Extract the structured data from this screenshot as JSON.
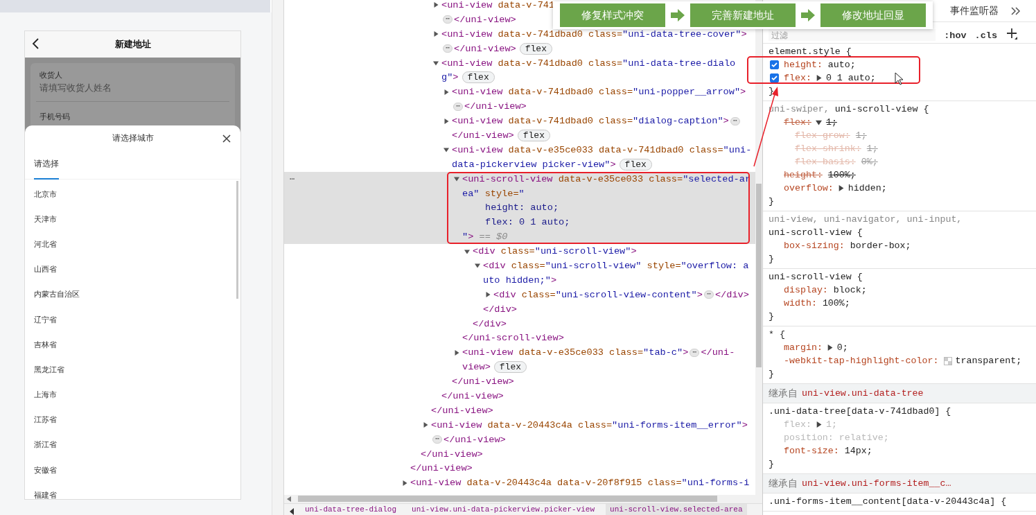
{
  "left_pane": {
    "page_title": "新建地址",
    "form": [
      {
        "label": "收货人",
        "placeholder": "请填写收货人姓名"
      },
      {
        "label": "手机号码"
      }
    ],
    "picker": {
      "title": "请选择城市",
      "tabs": [
        {
          "label": "请选择",
          "selected": true
        }
      ],
      "items": [
        "北京市",
        "天津市",
        "河北省",
        "山西省",
        "内蒙古自治区",
        "辽宁省",
        "吉林省",
        "黑龙江省",
        "上海市",
        "江苏省",
        "浙江省",
        "安徽省",
        "福建省"
      ]
    }
  },
  "overlay_steps": [
    "修复样式冲突",
    "完善新建地址",
    "修改地址回显"
  ],
  "elements": {
    "tree": [
      {
        "close": [
          {
            "kind": "tag",
            "text": "</uni-view>"
          }
        ],
        "children": [
          {
            "close": [
              {
                "kind": "tag",
                "text": "</uni-view>"
              }
            ],
            "children": [
              {
                "close": [
                  {
                    "kind": "tag",
                    "text": "</uni-view>"
                  }
                ],
                "children": [
                  {
                    "lines": [
                      [
                        {
                          "kind": "tag",
                          "text": "<uni-view"
                        },
                        {
                          "kind": "attr",
                          "text": " data-v-741"
                        }
                      ],
                      [
                        {
                          "kind": "more",
                          "text": "⋯"
                        },
                        {
                          "kind": "tag",
                          "text": "</uni-view>"
                        }
                      ]
                    ],
                    "expanded": false,
                    "selected": false
                  },
                  {
                    "lines": [
                      [
                        {
                          "kind": "tag",
                          "text": "<uni-view"
                        },
                        {
                          "kind": "attr",
                          "text": " data-v-741dbad0"
                        },
                        {
                          "kind": "attr",
                          "text": " class="
                        },
                        {
                          "kind": "value",
                          "text": "\"uni-data-tree-cover\""
                        },
                        {
                          "kind": "tag",
                          "text": ">"
                        }
                      ],
                      [
                        {
                          "kind": "more",
                          "text": "⋯"
                        },
                        {
                          "kind": "tag",
                          "text": "</uni-view>"
                        }
                      ]
                    ],
                    "badge": "flex",
                    "expanded": false,
                    "selected": false
                  },
                  {
                    "lines": [
                      [
                        {
                          "kind": "tag",
                          "text": "<uni-view"
                        },
                        {
                          "kind": "attr",
                          "text": " data-v-741dbad0"
                        },
                        {
                          "kind": "attr",
                          "text": " class="
                        },
                        {
                          "kind": "value",
                          "text": "\"uni-data-tree-dialo"
                        }
                      ],
                      [
                        {
                          "kind": "value",
                          "text": "g\""
                        },
                        {
                          "kind": "tag",
                          "text": ">"
                        }
                      ]
                    ],
                    "badge": "flex",
                    "expanded": true,
                    "selected": false,
                    "close": [
                      {
                        "kind": "tag",
                        "text": "</uni-view>"
                      }
                    ],
                    "children": [
                      {
                        "lines": [
                          [
                            {
                              "kind": "tag",
                              "text": "<uni-view"
                            },
                            {
                              "kind": "attr",
                              "text": " data-v-741dbad0"
                            },
                            {
                              "kind": "attr",
                              "text": " class="
                            },
                            {
                              "kind": "value",
                              "text": "\"uni-popper__arrow\""
                            },
                            {
                              "kind": "tag",
                              "text": ">"
                            }
                          ],
                          [
                            {
                              "kind": "more",
                              "text": "⋯"
                            },
                            {
                              "kind": "tag",
                              "text": "</uni-view>"
                            }
                          ]
                        ],
                        "expanded": false,
                        "selected": false
                      },
                      {
                        "lines": [
                          [
                            {
                              "kind": "tag",
                              "text": "<uni-view"
                            },
                            {
                              "kind": "attr",
                              "text": " data-v-741dbad0"
                            },
                            {
                              "kind": "attr",
                              "text": " class="
                            },
                            {
                              "kind": "value",
                              "text": "\"dialog-caption\""
                            },
                            {
                              "kind": "tag",
                              "text": ">"
                            },
                            {
                              "kind": "more",
                              "text": "⋯"
                            }
                          ],
                          [
                            {
                              "kind": "tag",
                              "text": "</uni-view>"
                            }
                          ]
                        ],
                        "badge": "flex",
                        "expanded": false,
                        "selected": false
                      },
                      {
                        "lines": [
                          [
                            {
                              "kind": "tag",
                              "text": "<uni-view"
                            },
                            {
                              "kind": "attr",
                              "text": " data-v-e35ce033"
                            },
                            {
                              "kind": "attr",
                              "text": " data-v-741dbad0"
                            },
                            {
                              "kind": "attr",
                              "text": " class="
                            },
                            {
                              "kind": "value",
                              "text": "\"uni-"
                            }
                          ],
                          [
                            {
                              "kind": "value",
                              "text": "data-pickerview picker-view\""
                            },
                            {
                              "kind": "tag",
                              "text": ">"
                            }
                          ]
                        ],
                        "badge": "flex",
                        "expanded": true,
                        "selected": false,
                        "close": [
                          {
                            "kind": "tag",
                            "text": "</uni-view>"
                          }
                        ],
                        "children": [
                          {
                            "lines": [
                              [
                                {
                                  "kind": "tag",
                                  "text": "<uni-scroll-view"
                                },
                                {
                                  "kind": "attr",
                                  "text": " data-v-e35ce033"
                                },
                                {
                                  "kind": "attr",
                                  "text": " class="
                                },
                                {
                                  "kind": "value",
                                  "text": "\"selected-ar"
                                }
                              ],
                              [
                                {
                                  "kind": "value",
                                  "text": "ea\""
                                },
                                {
                                  "kind": "attr",
                                  "text": " style="
                                },
                                {
                                  "kind": "value",
                                  "text": "\""
                                }
                              ],
                              [
                                {
                                  "kind": "css",
                                  "text": "height: auto;"
                                }
                              ],
                              [
                                {
                                  "kind": "css",
                                  "text": "flex: 0 1 auto;"
                                }
                              ],
                              [
                                {
                                  "kind": "value",
                                  "text": "\""
                                },
                                {
                                  "kind": "tag",
                                  "text": ">"
                                },
                                {
                                  "kind": "ref",
                                  "text": " == $0"
                                }
                              ]
                            ],
                            "gutter": "⋯",
                            "expanded": true,
                            "selected": true,
                            "highlighted": true,
                            "close": [
                              {
                                "kind": "tag",
                                "text": "</uni-scroll-view>"
                              }
                            ],
                            "children": [
                              {
                                "lines": [
                                  [
                                    {
                                      "kind": "tag",
                                      "text": "<div"
                                    },
                                    {
                                      "kind": "attr",
                                      "text": " class="
                                    },
                                    {
                                      "kind": "value",
                                      "text": "\"uni-scroll-view\""
                                    },
                                    {
                                      "kind": "tag",
                                      "text": ">"
                                    }
                                  ]
                                ],
                                "expanded": true,
                                "selected": false,
                                "close": [
                                  {
                                    "kind": "tag",
                                    "text": "</div>"
                                  }
                                ],
                                "children": [
                                  {
                                    "lines": [
                                      [
                                        {
                                          "kind": "tag",
                                          "text": "<div"
                                        },
                                        {
                                          "kind": "attr",
                                          "text": " class="
                                        },
                                        {
                                          "kind": "value",
                                          "text": "\"uni-scroll-view\""
                                        },
                                        {
                                          "kind": "attr",
                                          "text": " style="
                                        },
                                        {
                                          "kind": "value",
                                          "text": "\"overflow: a"
                                        }
                                      ],
                                      [
                                        {
                                          "kind": "value",
                                          "text": "uto hidden;\""
                                        },
                                        {
                                          "kind": "tag",
                                          "text": ">"
                                        }
                                      ]
                                    ],
                                    "expanded": true,
                                    "selected": false,
                                    "close": [
                                      {
                                        "kind": "tag",
                                        "text": "</div>"
                                      }
                                    ],
                                    "children": [
                                      {
                                        "lines": [
                                          [
                                            {
                                              "kind": "tag",
                                              "text": "<div"
                                            },
                                            {
                                              "kind": "attr",
                                              "text": " class="
                                            },
                                            {
                                              "kind": "value",
                                              "text": "\"uni-scroll-view-content\""
                                            },
                                            {
                                              "kind": "tag",
                                              "text": ">"
                                            },
                                            {
                                              "kind": "more",
                                              "text": "⋯"
                                            },
                                            {
                                              "kind": "tag",
                                              "text": "</div>"
                                            }
                                          ]
                                        ],
                                        "expanded": false,
                                        "selected": false
                                      }
                                    ]
                                  }
                                ]
                              }
                            ]
                          },
                          {
                            "lines": [
                              [
                                {
                                  "kind": "tag",
                                  "text": "<uni-view"
                                },
                                {
                                  "kind": "attr",
                                  "text": " data-v-e35ce033"
                                },
                                {
                                  "kind": "attr",
                                  "text": " class="
                                },
                                {
                                  "kind": "value",
                                  "text": "\"tab-c\""
                                },
                                {
                                  "kind": "tag",
                                  "text": ">"
                                },
                                {
                                  "kind": "more",
                                  "text": "⋯"
                                },
                                {
                                  "kind": "tag",
                                  "text": "</uni-"
                                }
                              ],
                              [
                                {
                                  "kind": "tag",
                                  "text": "view>"
                                }
                              ]
                            ],
                            "badge": "flex",
                            "expanded": false,
                            "selected": false
                          }
                        ]
                      }
                    ]
                  }
                ]
              },
              {
                "lines": [
                  [
                    {
                      "kind": "tag",
                      "text": "<uni-view"
                    },
                    {
                      "kind": "attr",
                      "text": " data-v-20443c4a"
                    },
                    {
                      "kind": "attr",
                      "text": " class="
                    },
                    {
                      "kind": "value",
                      "text": "\"uni-forms-item__error\""
                    },
                    {
                      "kind": "tag",
                      "text": ">"
                    }
                  ],
                  [
                    {
                      "kind": "more",
                      "text": "⋯"
                    },
                    {
                      "kind": "tag",
                      "text": "</uni-view>"
                    }
                  ]
                ],
                "expanded": false,
                "selected": false
              }
            ]
          }
        ]
      },
      {
        "lines": [
          [
            {
              "kind": "tag",
              "text": "<uni-view"
            },
            {
              "kind": "attr",
              "text": " data-v-20443c4a"
            },
            {
              "kind": "attr",
              "text": " data-v-20f8f915"
            },
            {
              "kind": "attr",
              "text": " class="
            },
            {
              "kind": "value",
              "text": "\"uni-forms-i"
            }
          ]
        ],
        "expanded": false,
        "selected": false
      }
    ],
    "breadcrumbs": [
      {
        "label": "uni-data-tree-dialog",
        "selected": false
      },
      {
        "label": "uni-view.uni-data-pickerview.picker-view",
        "selected": false
      },
      {
        "label": "uni-scroll-view.selected-area",
        "selected": true
      }
    ]
  },
  "styles": {
    "tabs": [
      {
        "label": "事件监听器",
        "selected": false
      }
    ],
    "filter": {
      "placeholder": "过滤"
    },
    "tools": [
      ":hov",
      ".cls"
    ],
    "sections": [
      {
        "kind": "rule",
        "highlighted": true,
        "selector": [
          {
            "text": "element.style {",
            "matched": true
          }
        ],
        "close": "}",
        "declarations": [
          {
            "name": "height:",
            "value": "auto;",
            "checked": true
          },
          {
            "name": "flex:",
            "expanded": false,
            "value": "0 1 auto;",
            "checked": true
          }
        ]
      },
      {
        "kind": "rule",
        "selector": [
          {
            "text": "uni-swiper,",
            "matched": false
          },
          {
            "text": "uni-scroll-view {",
            "matched": true
          }
        ],
        "close": "}",
        "declarations": [
          {
            "name": "flex:",
            "expanded": true,
            "value": "1;",
            "overridden": true,
            "children": [
              {
                "name": "flex-grow:",
                "value": "1;",
                "overridden": true
              },
              {
                "name": "flex-shrink:",
                "value": "1;",
                "overridden": true
              },
              {
                "name": "flex-basis:",
                "value": "0%;",
                "overridden": true
              }
            ]
          },
          {
            "name": "height:",
            "value": "100%;",
            "overridden": true
          },
          {
            "name": "overflow:",
            "expanded": false,
            "value": "hidden;"
          }
        ]
      },
      {
        "kind": "rule",
        "selector": [
          {
            "text": "uni-view,",
            "matched": false
          },
          {
            "text": "uni-navigator,",
            "matched": false
          },
          {
            "text": "uni-input,",
            "matched": false
          },
          {
            "text": "uni-scroll-view {",
            "matched": true
          }
        ],
        "close": "}",
        "declarations": [
          {
            "name": "box-sizing:",
            "value": "border-box;"
          }
        ]
      },
      {
        "kind": "rule",
        "selector": [
          {
            "text": "uni-scroll-view {",
            "matched": true
          }
        ],
        "close": "}",
        "declarations": [
          {
            "name": "display:",
            "value": "block;"
          },
          {
            "name": "width:",
            "value": "100%;"
          }
        ]
      },
      {
        "kind": "rule",
        "selector": [
          {
            "text": "* {",
            "matched": true
          }
        ],
        "close": "}",
        "declarations": [
          {
            "name": "margin:",
            "expanded": false,
            "value": "0;"
          },
          {
            "name": "-webkit-tap-highlight-color:",
            "value": "transparent;",
            "swatch": true
          }
        ]
      },
      {
        "kind": "inherited",
        "label": "继承自",
        "source": "uni-view.uni-data-tree"
      },
      {
        "kind": "rule",
        "selector": [
          {
            "text": ".uni-data-tree[data-v-741dbad0] {",
            "matched": true
          }
        ],
        "close": "}",
        "declarations": [
          {
            "name": "flex:",
            "expanded": false,
            "value": "1;",
            "inactive": true
          },
          {
            "name": "position:",
            "value": "relative;",
            "inactive": true
          },
          {
            "name": "font-size:",
            "value": "14px;"
          }
        ]
      },
      {
        "kind": "inherited",
        "label": "继承自",
        "source": "uni-view.uni-forms-item__c…"
      },
      {
        "kind": "rule",
        "selector": [
          {
            "text": ".uni-forms-item__content[data-v-20443c4a] {",
            "matched": true
          }
        ]
      }
    ]
  }
}
